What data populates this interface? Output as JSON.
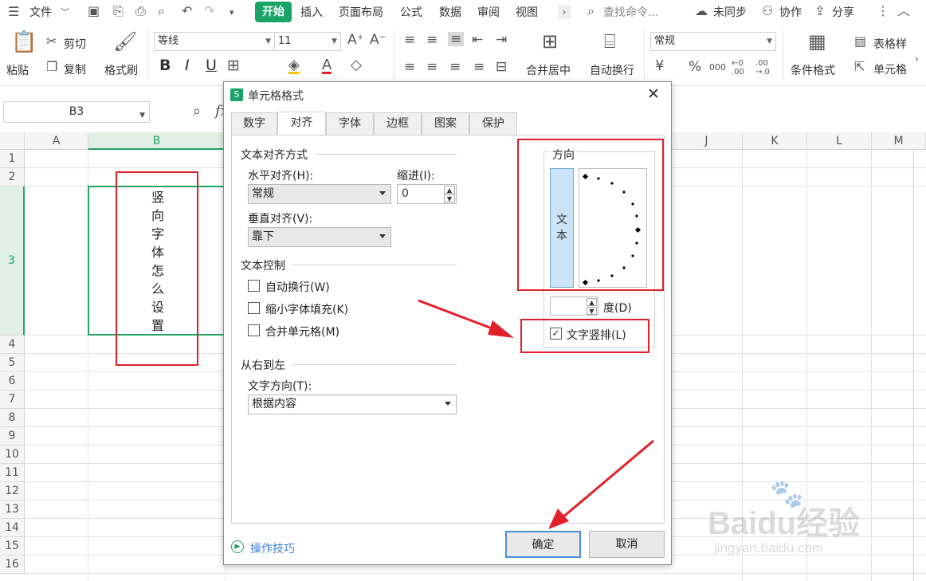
{
  "menubar": {
    "file": "文件",
    "tabs": [
      "开始",
      "插入",
      "页面布局",
      "公式",
      "数据",
      "审阅",
      "视图"
    ],
    "search_placeholder": "查找命令...",
    "sync": "未同步",
    "collab": "协作",
    "share": "分享"
  },
  "ribbon": {
    "paste": "粘贴",
    "cut": "剪切",
    "copy": "复制",
    "format_painter": "格式刷",
    "font_name": "等线",
    "font_size": "11",
    "merge_center": "合并居中",
    "wrap_text": "自动换行",
    "number_format": "常规",
    "conditional_format": "条件格式",
    "table_style": "表格样",
    "cell": "单元格",
    "bold": "B",
    "italic": "I",
    "underline": "U",
    "percent": "%",
    "thousands": "000",
    "dec_inc": "←0 .00",
    "dec_dec": ".00 →.0"
  },
  "formula_bar": {
    "name_box": "B3",
    "fx": "fx"
  },
  "grid": {
    "columns": [
      "A",
      "B",
      "J",
      "K",
      "L",
      "M"
    ],
    "rows": [
      "1",
      "2",
      "3",
      "4",
      "5",
      "6",
      "7",
      "8",
      "9",
      "10",
      "11",
      "12",
      "13",
      "14",
      "15",
      "16"
    ],
    "cell_b3_chars": [
      "竖",
      "向",
      "字",
      "体",
      "怎",
      "么",
      "设",
      "置"
    ]
  },
  "dialog": {
    "title": "单元格格式",
    "tabs": [
      "数字",
      "对齐",
      "字体",
      "边框",
      "图案",
      "保护"
    ],
    "active_tab": "对齐",
    "text_align_group": "文本对齐方式",
    "h_align_label": "水平对齐(H):",
    "h_align_value": "常规",
    "indent_label": "缩进(I):",
    "indent_value": "0",
    "v_align_label": "垂直对齐(V):",
    "v_align_value": "靠下",
    "text_control_group": "文本控制",
    "wrap_label": "自动换行(W)",
    "shrink_label": "缩小字体填充(K)",
    "merge_label": "合并单元格(M)",
    "rtl_group": "从右到左",
    "text_dir_label": "文字方向(T):",
    "text_dir_value": "根据内容",
    "orientation_group": "方向",
    "orientation_text": "文本",
    "degree_label": "度(D)",
    "vertical_text_label": "文字竖排(L)",
    "vertical_text_checked": true,
    "tips": "操作技巧",
    "ok": "确定",
    "cancel": "取消"
  },
  "watermark": {
    "brand": "Baidu经验",
    "url": "jingyan.baidu.com"
  },
  "colors": {
    "accent_green": "#1aa368",
    "annotation_red": "#e2202a",
    "selection_green": "#21a366",
    "orientation_blue": "#cce4f7"
  }
}
